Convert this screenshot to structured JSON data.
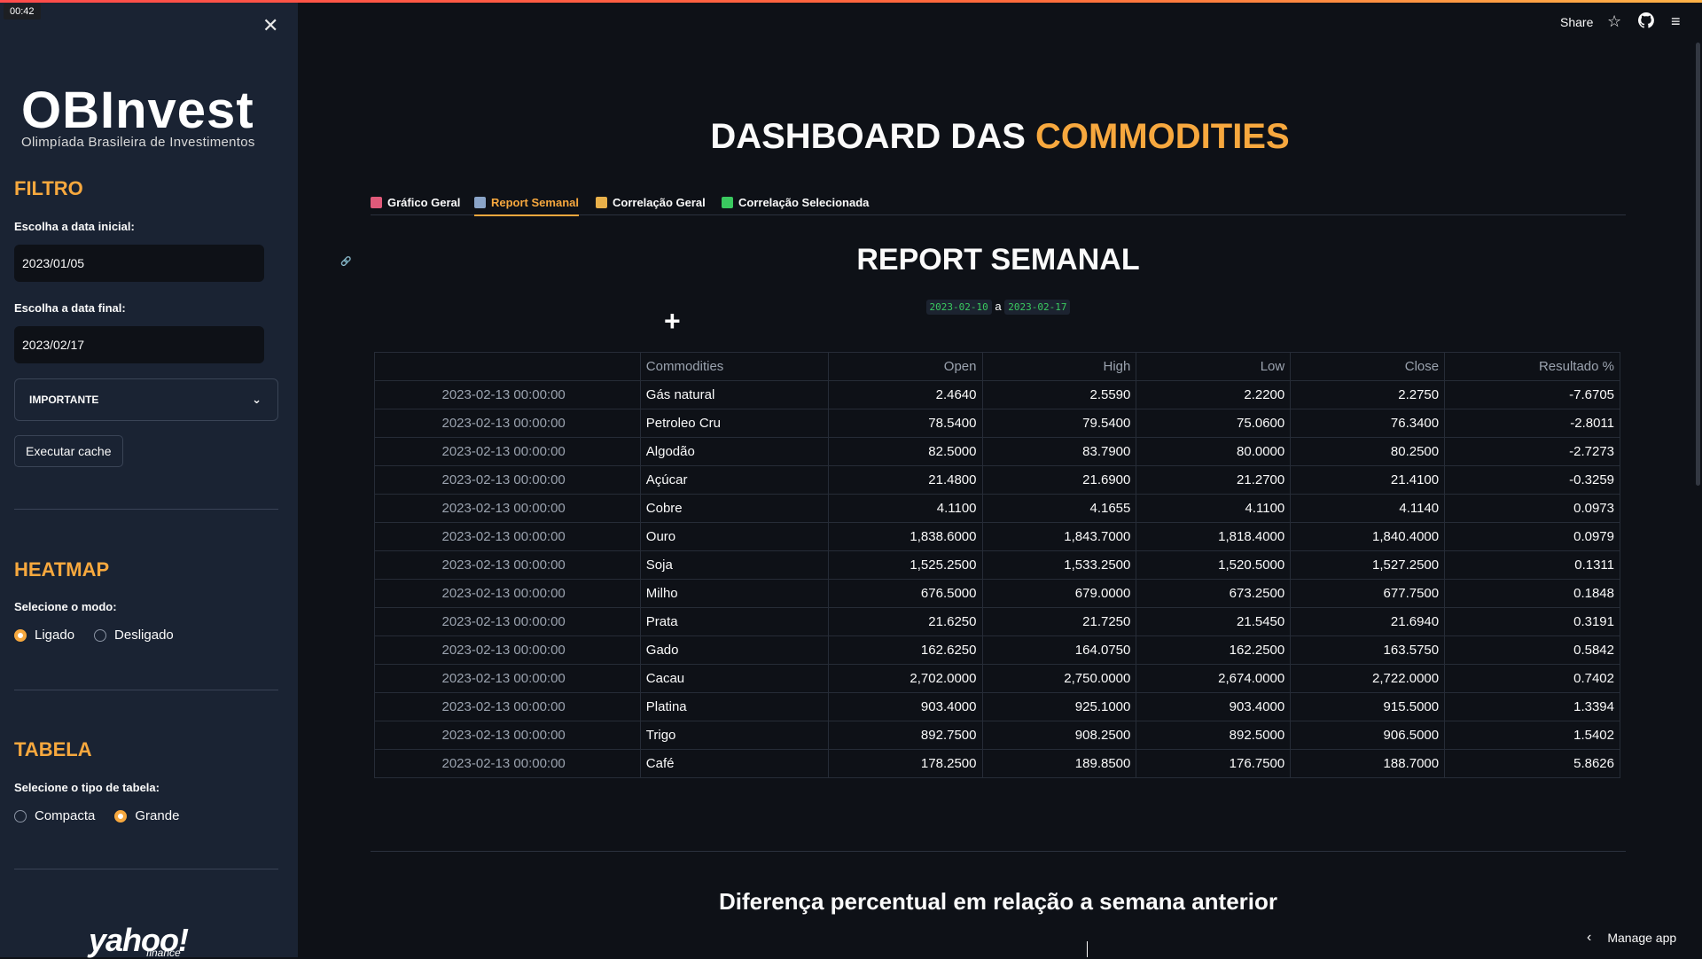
{
  "timer": "00:42",
  "sidebar": {
    "logo_main": "OBInvest",
    "logo_sub": "Olimpíada Brasileira de Investimentos",
    "filtro": {
      "heading": "FILTRO",
      "start_label": "Escolha a data inicial:",
      "start_value": "2023/01/05",
      "end_label": "Escolha a data final:",
      "end_value": "2023/02/17",
      "select_value": "IMPORTANTE",
      "button_label": "Executar cache"
    },
    "heatmap": {
      "heading": "HEATMAP",
      "label": "Selecione o modo:",
      "option_on": "Ligado",
      "option_off": "Desligado",
      "selected": "Ligado"
    },
    "tabela": {
      "heading": "TABELA",
      "label": "Selecione o tipo de tabela:",
      "option_compact": "Compacta",
      "option_large": "Grande",
      "selected": "Grande"
    },
    "yahoo": "yahoo!",
    "yahoo_sub": "finance"
  },
  "toolbar": {
    "share_label": "Share"
  },
  "main": {
    "title_part1": "DASHBOARD DAS ",
    "title_part2": "COMMODITIES",
    "tabs": [
      {
        "label": "Gráfico Geral",
        "icon": "chart-icon",
        "color": "#e05a7a"
      },
      {
        "label": "Report Semanal",
        "icon": "calendar-icon",
        "color": "#8aa4c8"
      },
      {
        "label": "Correlação Geral",
        "icon": "people-icon",
        "color": "#e8b04a"
      },
      {
        "label": "Correlação Selecionada",
        "icon": "check-icon",
        "color": "#3ac95f"
      }
    ],
    "active_tab": "Report Semanal",
    "section_title": "REPORT SEMANAL",
    "date_from": "2023-02-10",
    "date_sep": "a",
    "date_to": "2023-02-17",
    "subtitle": "Diferença percentual em relação a semana anterior"
  },
  "table": {
    "headers": [
      "",
      "Commodities",
      "Open",
      "High",
      "Low",
      "Close",
      "Resultado %"
    ],
    "rows": [
      [
        "2023-02-13 00:00:00",
        "Gás natural",
        "2.4640",
        "2.5590",
        "2.2200",
        "2.2750",
        "-7.6705"
      ],
      [
        "2023-02-13 00:00:00",
        "Petroleo Cru",
        "78.5400",
        "79.5400",
        "75.0600",
        "76.3400",
        "-2.8011"
      ],
      [
        "2023-02-13 00:00:00",
        "Algodão",
        "82.5000",
        "83.7900",
        "80.0000",
        "80.2500",
        "-2.7273"
      ],
      [
        "2023-02-13 00:00:00",
        "Açúcar",
        "21.4800",
        "21.6900",
        "21.2700",
        "21.4100",
        "-0.3259"
      ],
      [
        "2023-02-13 00:00:00",
        "Cobre",
        "4.1100",
        "4.1655",
        "4.1100",
        "4.1140",
        "0.0973"
      ],
      [
        "2023-02-13 00:00:00",
        "Ouro",
        "1,838.6000",
        "1,843.7000",
        "1,818.4000",
        "1,840.4000",
        "0.0979"
      ],
      [
        "2023-02-13 00:00:00",
        "Soja",
        "1,525.2500",
        "1,533.2500",
        "1,520.5000",
        "1,527.2500",
        "0.1311"
      ],
      [
        "2023-02-13 00:00:00",
        "Milho",
        "676.5000",
        "679.0000",
        "673.2500",
        "677.7500",
        "0.1848"
      ],
      [
        "2023-02-13 00:00:00",
        "Prata",
        "21.6250",
        "21.7250",
        "21.5450",
        "21.6940",
        "0.3191"
      ],
      [
        "2023-02-13 00:00:00",
        "Gado",
        "162.6250",
        "164.0750",
        "162.2500",
        "163.5750",
        "0.5842"
      ],
      [
        "2023-02-13 00:00:00",
        "Cacau",
        "2,702.0000",
        "2,750.0000",
        "2,674.0000",
        "2,722.0000",
        "0.7402"
      ],
      [
        "2023-02-13 00:00:00",
        "Platina",
        "903.4000",
        "925.1000",
        "903.4000",
        "915.5000",
        "1.3394"
      ],
      [
        "2023-02-13 00:00:00",
        "Trigo",
        "892.7500",
        "908.2500",
        "892.5000",
        "906.5000",
        "1.5402"
      ],
      [
        "2023-02-13 00:00:00",
        "Café",
        "178.2500",
        "189.8500",
        "176.7500",
        "188.7000",
        "5.8626"
      ]
    ]
  },
  "footer": {
    "manage_label": "Manage app"
  },
  "colors": {
    "accent": "#f7a83e",
    "background": "#0e1117",
    "sidebar": "#1a2333"
  }
}
